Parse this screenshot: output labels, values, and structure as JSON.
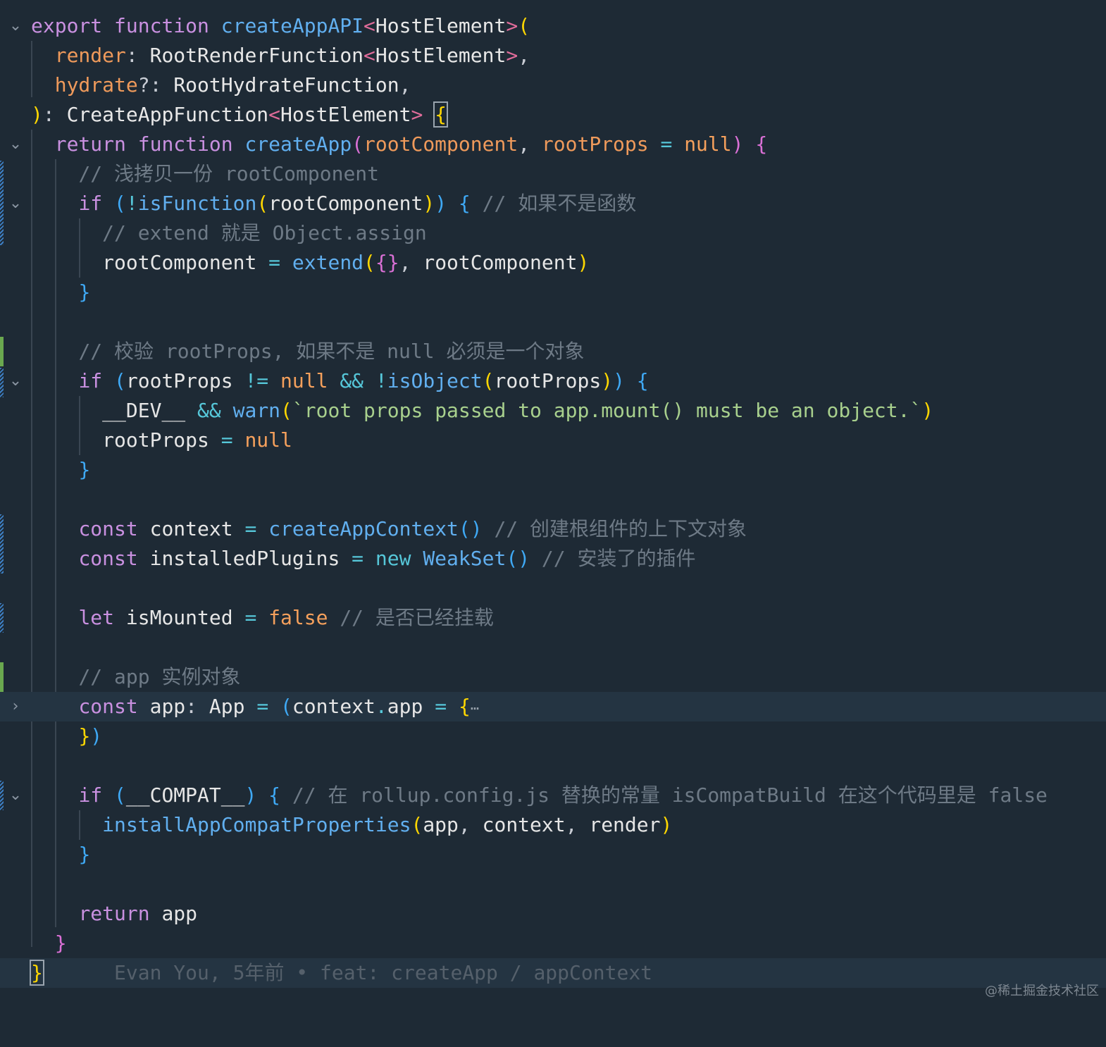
{
  "watermark": "@稀土掘金技术社区",
  "code": {
    "l1": {
      "k": "export",
      "k2": "function",
      "fn": "createAppAPI",
      "lt": "<",
      "ty": "HostElement",
      "gt": ">",
      "p": "("
    },
    "l2": {
      "pm": "render",
      "c": ":",
      "ty": "RootRenderFunction",
      "lt": "<",
      "ty2": "HostElement",
      "gt": ">",
      "com": ","
    },
    "l3": {
      "pm": "hydrate",
      "q": "?:",
      "ty": "RootHydrateFunction",
      "com": ","
    },
    "l4": {
      "p": ")",
      "c": ":",
      "ty": "CreateAppFunction",
      "lt": "<",
      "ty2": "HostElement",
      "gt": ">",
      "b": "{"
    },
    "l5": {
      "k": "return",
      "k2": "function",
      "fn": "createApp",
      "p": "(",
      "a1": "rootComponent",
      "com": ",",
      "a2": "rootProps",
      "eq": "=",
      "nul": "null",
      "p2": ")",
      "b": "{"
    },
    "l6": {
      "cm": "// 浅拷贝一份 rootComponent"
    },
    "l7": {
      "k": "if",
      "p": "(",
      "op": "!",
      "fn": "isFunction",
      "p2": "(",
      "id": "rootComponent",
      "p3": ")",
      "p4": ")",
      "b": "{",
      "cm": "// 如果不是函数"
    },
    "l8": {
      "cm": "// extend 就是 Object.assign"
    },
    "l9": {
      "id": "rootComponent",
      "eq": "=",
      "fn": "extend",
      "p": "(",
      "b": "{}",
      "com": ",",
      "id2": "rootComponent",
      "p2": ")"
    },
    "l10": {
      "b": "}"
    },
    "l12": {
      "cm": "// 校验 rootProps, 如果不是 null 必须是一个对象"
    },
    "l13": {
      "k": "if",
      "p": "(",
      "id": "rootProps",
      "op": "!=",
      "nul": "null",
      "and": "&&",
      "op2": "!",
      "fn": "isObject",
      "p2": "(",
      "id2": "rootProps",
      "p3": ")",
      "p4": ")",
      "b": "{"
    },
    "l14": {
      "id": "__DEV__",
      "and": "&&",
      "fn": "warn",
      "p": "(",
      "str": "`root props passed to app.mount() must be an object.`",
      "p2": ")"
    },
    "l15": {
      "id": "rootProps",
      "eq": "=",
      "nul": "null"
    },
    "l16": {
      "b": "}"
    },
    "l18": {
      "k": "const",
      "id": "context",
      "eq": "=",
      "fn": "createAppContext",
      "p": "()",
      "cm": "// 创建根组件的上下文对象"
    },
    "l19": {
      "k": "const",
      "id": "installedPlugins",
      "eq": "=",
      "k2": "new",
      "fn": "WeakSet",
      "p": "()",
      "cm": "// 安装了的插件"
    },
    "l21": {
      "k": "let",
      "id": "isMounted",
      "eq": "=",
      "cn": "false",
      "cm": "// 是否已经挂载"
    },
    "l23": {
      "cm": "// app 实例对象"
    },
    "l24": {
      "k": "const",
      "id": "app",
      "c": ":",
      "ty": "App",
      "eq": "=",
      "p": "(",
      "id2": "context",
      "dot": ".",
      "id3": "app",
      "eq2": "=",
      "b": "{",
      "ell": "⋯"
    },
    "l25": {
      "b": "}",
      "p": ")"
    },
    "l27": {
      "k": "if",
      "p": "(",
      "id": "__COMPAT__",
      "p2": ")",
      "b": "{",
      "cm": "// 在 rollup.config.js 替换的常量 isCompatBuild 在这个代码里是 false"
    },
    "l28": {
      "fn": "installAppCompatProperties",
      "p": "(",
      "a1": "app",
      "com": ",",
      "a2": "context",
      "com2": ",",
      "a3": "render",
      "p2": ")"
    },
    "l29": {
      "b": "}"
    },
    "l31": {
      "k": "return",
      "id": "app"
    },
    "l32": {
      "b": "}"
    },
    "l33": {
      "b": "}",
      "blame": "Evan You, 5年前 • feat: createApp / appContext"
    }
  },
  "colors": {
    "background": "#1e2a35",
    "keyword": "#c990e0",
    "function": "#61afef",
    "string": "#a8d08d",
    "comment": "#6e7a86",
    "parameter": "#ef9a5b",
    "added_marker": "#6aa84f",
    "modified_marker": "#3d7fc4"
  },
  "icons": {
    "fold_open": "chevron-down-icon",
    "fold_closed": "chevron-right-icon"
  }
}
